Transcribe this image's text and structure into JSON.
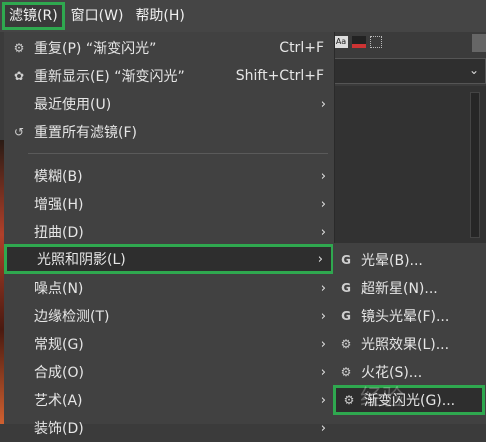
{
  "menubar": {
    "items": [
      {
        "label": "滤镜(R)"
      },
      {
        "label": "窗口(W)"
      },
      {
        "label": "帮助(H)"
      }
    ]
  },
  "right_panel": {
    "aa_label": "Aa"
  },
  "menu": {
    "repeat": {
      "label": "重复(P) “渐变闪光”",
      "shortcut": "Ctrl+F"
    },
    "reshow": {
      "label": "重新显示(E) “渐变闪光”",
      "shortcut": "Shift+Ctrl+F"
    },
    "recent": {
      "label": "最近使用(U)"
    },
    "reset_all": {
      "label": "重置所有滤镜(F)"
    },
    "blur": {
      "label": "模糊(B)"
    },
    "enhance": {
      "label": "增强(H)"
    },
    "distorts": {
      "label": "扭曲(D)"
    },
    "light_shadow": {
      "label": "光照和阴影(L)"
    },
    "noise": {
      "label": "噪点(N)"
    },
    "edge_detect": {
      "label": "边缘检测(T)"
    },
    "generic": {
      "label": "常规(G)"
    },
    "combine": {
      "label": "合成(O)"
    },
    "artistic": {
      "label": "艺术(A)"
    },
    "decor": {
      "label": "装饰(D)"
    }
  },
  "submenu": {
    "items": [
      {
        "label": "光晕(B)..."
      },
      {
        "label": "超新星(N)..."
      },
      {
        "label": "镜头光晕(F)..."
      },
      {
        "label": "光照效果(L)..."
      },
      {
        "label": "火花(S)..."
      },
      {
        "label": "渐变闪光(G)..."
      }
    ]
  },
  "watermark": "经验"
}
